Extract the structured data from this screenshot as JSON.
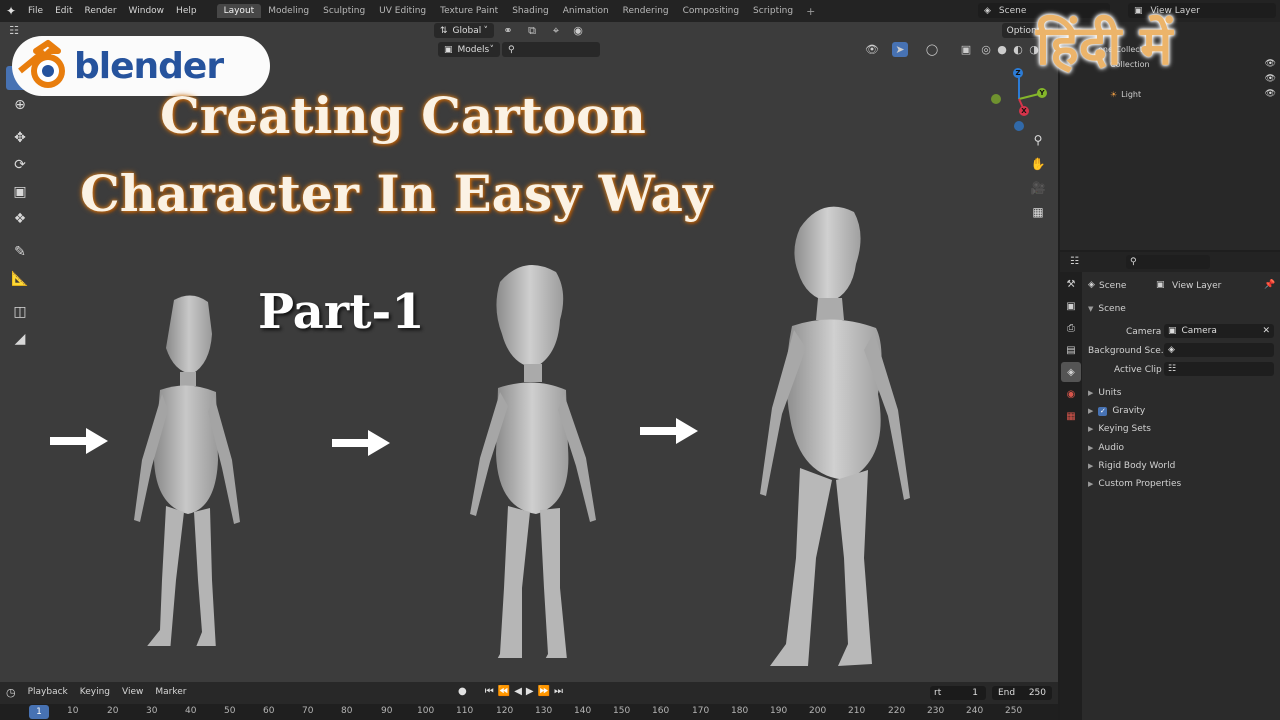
{
  "menu": {
    "items": [
      "File",
      "Edit",
      "Render",
      "Window",
      "Help"
    ],
    "workspaces": [
      "Layout",
      "Modeling",
      "Sculpting",
      "UV Editing",
      "Texture Paint",
      "Shading",
      "Animation",
      "Rendering",
      "Compositing",
      "Scripting"
    ],
    "active_workspace": "Layout",
    "add_tab": "+",
    "scene": "Scene",
    "view_layer": "View Layer"
  },
  "viewport": {
    "orientation": "Global",
    "search_filter": "Models",
    "options": "Options"
  },
  "gizmo": {
    "z": "Z",
    "y": "Y",
    "x": "X"
  },
  "thumbnail": {
    "logo_text": "blender",
    "title_line1": "Creating Cartoon",
    "title_line2": "Character In Easy Way",
    "part": "Part-1",
    "hindi": "हिंदी में",
    "colors": {
      "title_glow": "#c9771f",
      "hindi": "#ecb46a",
      "logo_blue": "#26539d",
      "logo_orange": "#e87d0d"
    }
  },
  "timeline": {
    "menus": [
      "Playback",
      "Keying",
      "View",
      "Marker"
    ],
    "current_frame": "1",
    "ticks": [
      "10",
      "20",
      "30",
      "40",
      "50",
      "60",
      "70",
      "80",
      "90",
      "100",
      "110",
      "120",
      "130",
      "140",
      "150",
      "160",
      "170",
      "180",
      "190",
      "200",
      "210",
      "220",
      "230",
      "240",
      "250"
    ],
    "start_label": "rt",
    "start_value": "1",
    "end_label": "End",
    "end_value": "250"
  },
  "outliner": {
    "rows": [
      "ene Collection",
      "Collection",
      "Light"
    ]
  },
  "properties": {
    "breadcrumb_scene": "Scene",
    "breadcrumb_layer": "View Layer",
    "section": "Scene",
    "camera_label": "Camera",
    "camera_value": "Camera",
    "background_label": "Background Sce...",
    "active_clip_label": "Active Clip",
    "panels": [
      "Units",
      "Gravity",
      "Keying Sets",
      "Audio",
      "Rigid Body World",
      "Custom Properties"
    ],
    "accent": "#4772b3"
  }
}
